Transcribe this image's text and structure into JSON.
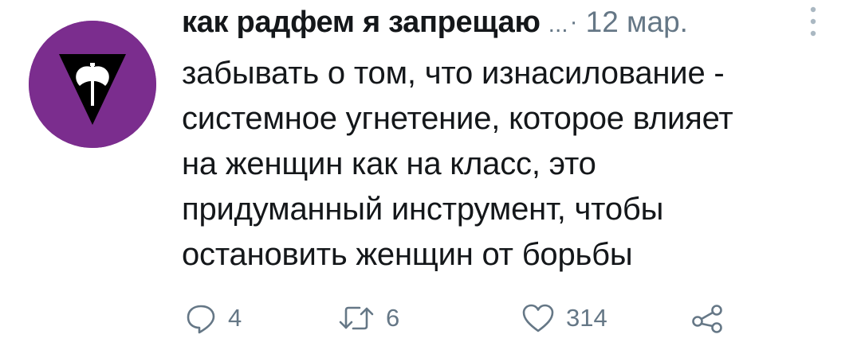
{
  "tweet": {
    "author_name": "как радфем я запрещаю",
    "handle": "...",
    "separator": "·",
    "date": "12 мар.",
    "avatar_icon": "labrys-triangle-icon",
    "avatar_color": "#7b2d8e",
    "text_lines": [
      "забывать о том, что изнасилование -",
      "системное угнетение, которое влияет",
      "на женщин как на класс, это",
      "придуманный инструмент, чтобы",
      "остановить женщин от борьбы"
    ],
    "actions": {
      "reply_count": "4",
      "retweet_count": "6",
      "like_count": "314"
    }
  }
}
